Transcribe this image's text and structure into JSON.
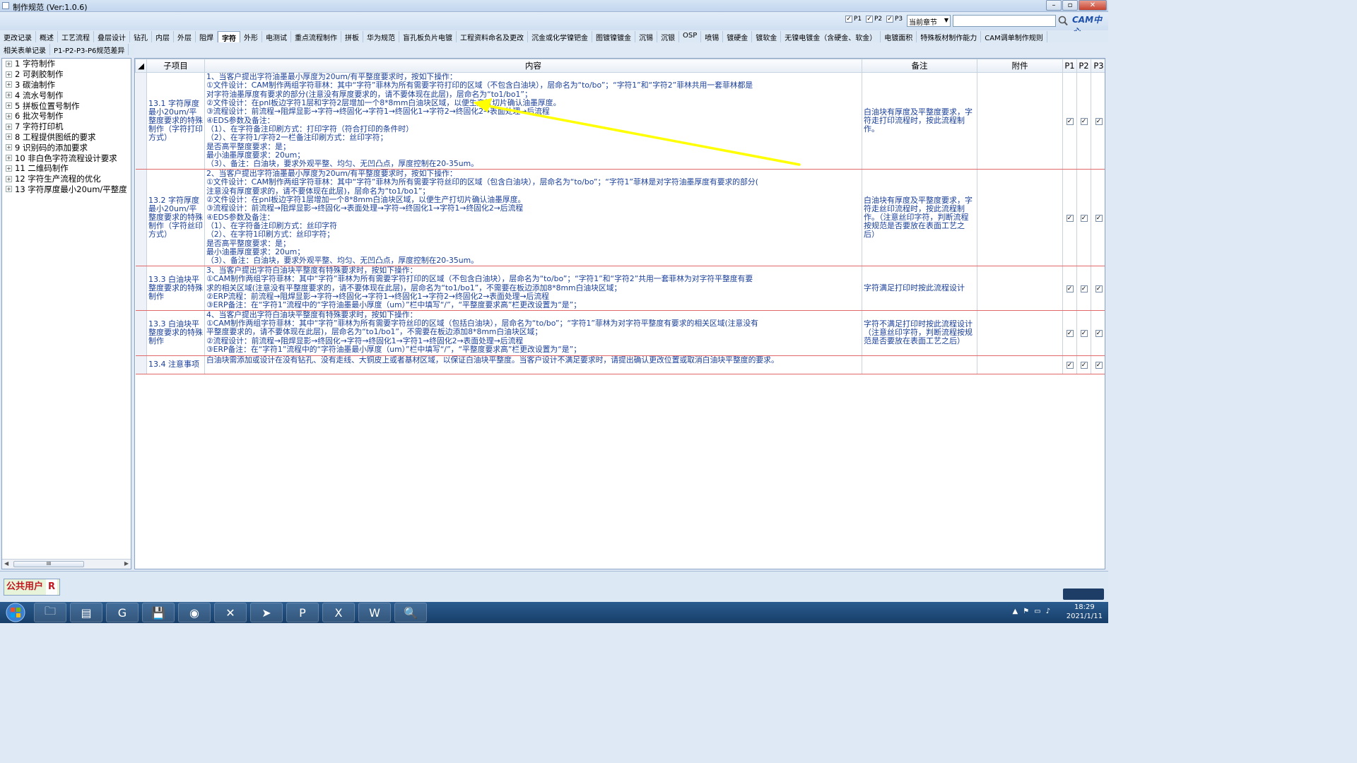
{
  "window": {
    "title": "制作规范 (Ver:1.0.6)"
  },
  "toolbar": {
    "checks": [
      {
        "label": "P1",
        "checked": true
      },
      {
        "label": "P2",
        "checked": true
      },
      {
        "label": "P3",
        "checked": true
      }
    ],
    "scope_select": "当前章节",
    "search_value": "",
    "logo": "CAM中心"
  },
  "tabs_row1": [
    "更改记录",
    "概述",
    "工艺流程",
    "叠层设计",
    "钻孔",
    "内层",
    "外层",
    "阻焊",
    "字符",
    "外形",
    "电测试",
    "重点流程制作",
    "拼板",
    "华为规范",
    "盲孔板负片电镀",
    "工程资料命名及更改",
    "沉金或化学镍钯金",
    "图镀镍镀金",
    "沉锡",
    "沉银",
    "OSP",
    "喷锡",
    "镀硬金",
    "镀软金",
    "无镍电镀金（含硬金、软金）",
    "电镀面积",
    "特殊板材制作能力",
    "CAM调单制作规则"
  ],
  "active_tab": "字符",
  "tabs_row2": [
    "相关表单记录",
    "P1-P2-P3-P6规范差异"
  ],
  "tree": [
    "1  字符制作",
    "2  可剥胶制作",
    "3  碳油制作",
    "4  流水号制作",
    "5  拼板位置号制作",
    "6  批次号制作",
    "7  字符打印机",
    "8  工程提供图纸的要求",
    "9  识别码的添加要求",
    "10  非白色字符流程设计要求",
    "11  二维码制作",
    "12  字符生产流程的优化",
    "13  字符厚度最小20um/平整度"
  ],
  "columns": {
    "sub": "子项目",
    "content": "内容",
    "remark": "备注",
    "attach": "附件",
    "p1": "P1",
    "p2": "P2",
    "p3": "P3"
  },
  "rows": [
    {
      "sub": "13.1 字符厚度最小20um/平整度要求的特殊制作（字符打印方式）",
      "lines": [
        "1、当客户提出字符油墨最小厚度为20um/有平整度要求时，按如下操作：",
        "①文件设计：CAM制作两组字符菲林：其中“字符”菲林为所有需要字符打印的区域（不包含白油块），层命名为“to/bo”；“字符1”和“字符2”菲林共用一套菲林都是",
        "对字符油墨厚度有要求的部分(注意没有厚度要求的，请不要体现在此层)，层命名为“to1/bo1”；",
        "②文件设计：在pnl板边字符1层和字符2层增加一个8*8mm白油块区域，以便生产打切片确认油墨厚度。",
        "③流程设计：前流程→阻焊显影→字符→终固化→字符1→终固化1→字符2→终固化2→表面处理→后流程",
        "④EDS参数及备注：",
        "（1）、在字符备注印刷方式：打印字符（符合打印的条件时）",
        "（2）、在字符1/字符2一栏备注印刷方式：丝印字符；",
        "          是否高平整度要求：是；",
        "          最小油墨厚度要求：20um；",
        "（3）、备注：白油块，要求外观平整、均匀、无凹凸点，厚度控制在20-35um。"
      ],
      "remark": "白油块有厚度及平整度要求，字符走打印流程时，按此流程制作。",
      "attach": "",
      "p1": true,
      "p2": true,
      "p3": true
    },
    {
      "sub": "13.2 字符厚度最小20um/平整度要求的特殊制作（字符丝印方式）",
      "lines": [
        "2、当客户提出字符油墨最小厚度为20um/有平整度要求时，按如下操作：",
        "①文件设计：CAM制作两组字符菲林：其中“字符”菲林为所有需要字符丝印的区域（包含白油块），层命名为“to/bo”；“字符1”菲林是对字符油墨厚度有要求的部分(",
        "注意没有厚度要求的，请不要体现在此层)，层命名为“to1/bo1”；",
        "②文件设计：在pnl板边字符1层增加一个8*8mm白油块区域，以便生产打切片确认油墨厚度。",
        "③流程设计：前流程→阻焊显影→终固化→表面处理→字符→终固化1→字符1→终固化2→后流程",
        "④EDS参数及备注：",
        "（1）、在字符备注印刷方式：丝印字符",
        "（2）、在字符1印刷方式：丝印字符；",
        "          是否高平整度要求：是；",
        "          最小油墨厚度要求：20um；",
        "（3）、备注：白油块，要求外观平整、均匀、无凹凸点，厚度控制在20-35um。"
      ],
      "remark": "白油块有厚度及平整度要求，字符走丝印流程时，按此流程制作。（注意丝印字符，判断流程按规范是否要放在表面工艺之后）",
      "attach": "",
      "p1": true,
      "p2": true,
      "p3": true
    },
    {
      "sub": "13.3 白油块平整度要求的特殊制作",
      "lines": [
        "3、当客户提出字符白油块平整度有特殊要求时，按如下操作：",
        "①CAM制作两组字符菲林：其中“字符”菲林为所有需要字符打印的区域（不包含白油块），层命名为“to/bo”；“字符1”和“字符2”共用一套菲林为对字符平整度有要",
        "求的相关区域(注意没有平整度要求的，请不要体现在此层)，层命名为“to1/bo1”，不需要在板边添加8*8mm白油块区域；",
        "②ERP流程：前流程→阻焊显影→字符→终固化→字符1→终固化1→字符2→终固化2→表面处理→后流程",
        "③ERP备注：在“字符1”流程中的“字符油墨最小厚度（um）”栏中填写“/”，“平整度要求高”栏更改设置为“是”；"
      ],
      "remark": "字符满足打印时按此流程设计",
      "attach": "",
      "p1": true,
      "p2": true,
      "p3": true
    },
    {
      "sub": "13.3 白油块平整度要求的特殊制作",
      "lines": [
        "4、当客户提出字符白油块平整度有特殊要求时，按如下操作：",
        "①CAM制作两组字符菲林：其中“字符”菲林为所有需要字符丝印的区域（包括白油块），层命名为“to/bo”；“字符1”菲林为对字符平整度有要求的相关区域(注意没有",
        "平整度要求的，请不要体现在此层)，层命名为“to1/bo1”，不需要在板边添加8*8mm白油块区域；",
        "②流程设计：前流程→阻焊显影→终固化→字符→终固化1→字符1→终固化2→表面处理→后流程",
        "③ERP备注：在“字符1”流程中的“字符油墨最小厚度（um）”栏中填写“/”，“平整度要求高”栏更改设置为“是”；"
      ],
      "remark": "字符不满足打印时按此流程设计（注意丝印字符，判断流程按规范是否要放在表面工艺之后）",
      "attach": "",
      "p1": true,
      "p2": true,
      "p3": true
    },
    {
      "sub": "13.4 注意事项",
      "lines": [
        "白油块需添加或设计在没有钻孔、没有走线、大铜皮上或者基材区域，以保证白油块平整度。当客户设计不满足要求时，请提出确认更改位置或取消白油块平整度的要求。"
      ],
      "remark": "",
      "attach": "",
      "p1": true,
      "p2": true,
      "p3": true
    }
  ],
  "status": {
    "user": "公共用户",
    "role": "R"
  },
  "taskbar": {
    "apps": [
      "explorer",
      "notepad",
      "browser",
      "floppy",
      "eye",
      "xmind",
      "paper-plane",
      "pads",
      "excel",
      "word",
      "search"
    ]
  },
  "clock": {
    "time": "18:29",
    "date": "2021/1/11"
  },
  "annotation": {
    "color": "#ffff00"
  }
}
